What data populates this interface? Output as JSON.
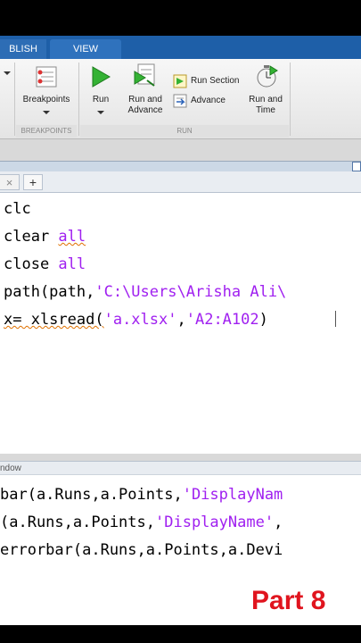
{
  "ribbon": {
    "tabs": [
      "BLISH",
      "VIEW"
    ],
    "buttons": {
      "breakpoints": "Breakpoints",
      "run": "Run",
      "run_and_advance": "Run and\nAdvance",
      "run_section": "Run Section",
      "advance": "Advance",
      "run_and_time": "Run and\nTime"
    },
    "groups": {
      "breakpoints": "BREAKPOINTS",
      "run": "RUN"
    }
  },
  "editor": {
    "tab_close": "×",
    "tab_add": "+",
    "lines": [
      {
        "plain": "clc"
      },
      {
        "plain": "clear ",
        "kw": "all"
      },
      {
        "plain": "close ",
        "kw": "all"
      },
      {
        "pre": "path(path,",
        "str": "'C:\\Users\\Arisha Ali\\"
      },
      {
        "pre": "x= xlsread(",
        "str1": "'a.xlsx'",
        "mid": ",",
        "str2": "'A2:A102",
        "post": ")"
      }
    ]
  },
  "command_window": {
    "title": "ndow",
    "lines": [
      {
        "pre": "bar(a.Runs,a.Points,",
        "str": "'DisplayNam"
      },
      {
        "pre": "(a.Runs,a.Points,",
        "str": "'DisplayName'",
        "post": ","
      },
      {
        "pre": "errorbar(a.Runs,a.Points,a.Devi"
      }
    ]
  },
  "overlay": {
    "part_label": "Part 8"
  },
  "colors": {
    "string": "#a020f0",
    "ribbon_tab": "#1e5fa8",
    "part_label": "#e0141e"
  }
}
